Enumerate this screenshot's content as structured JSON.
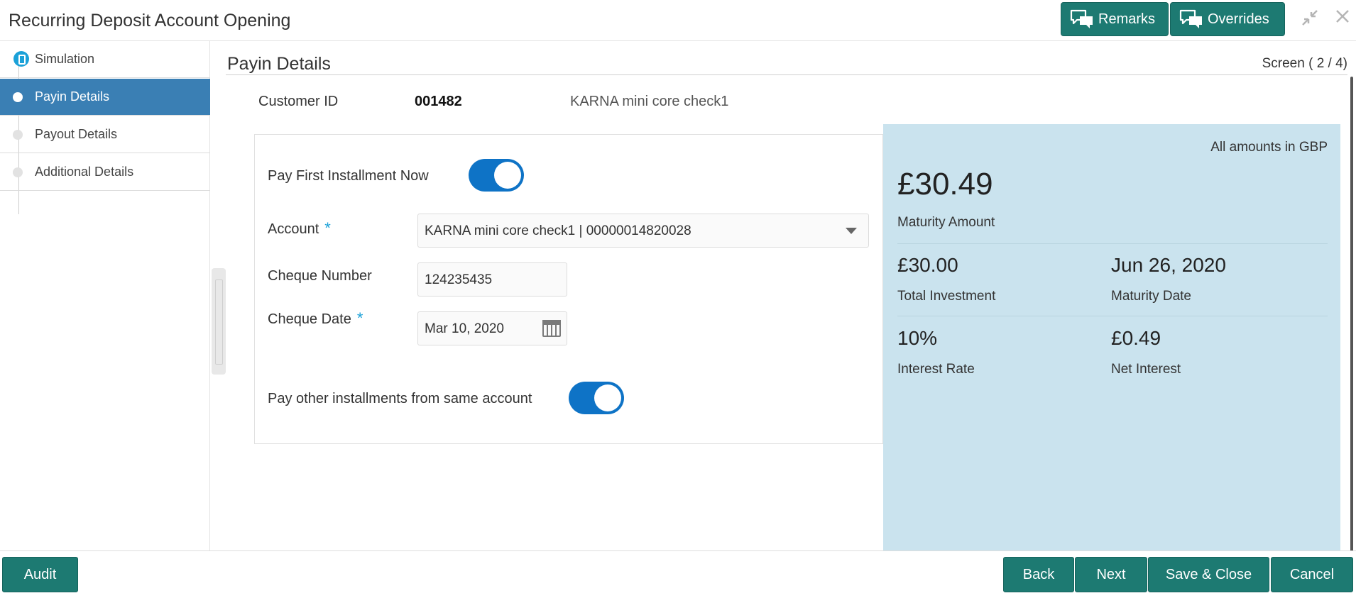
{
  "header": {
    "title": "Recurring Deposit Account Opening",
    "remarks_label": "Remarks",
    "overrides_label": "Overrides"
  },
  "sidebar": {
    "steps": [
      {
        "label": "Simulation",
        "state": "completed"
      },
      {
        "label": "Payin Details",
        "state": "active"
      },
      {
        "label": "Payout Details",
        "state": "pending"
      },
      {
        "label": "Additional Details",
        "state": "pending"
      }
    ]
  },
  "main": {
    "section_title": "Payin Details",
    "screen_indicator": "Screen ( 2 / 4)",
    "customer": {
      "label": "Customer ID",
      "id": "001482",
      "name": "KARNA mini core check1"
    },
    "form": {
      "pay_first_label": "Pay First Installment Now",
      "pay_first_on": true,
      "account_label": "Account",
      "account_value": "KARNA mini core check1 | 00000014820028",
      "cheque_number_label": "Cheque Number",
      "cheque_number_value": "124235435",
      "cheque_date_label": "Cheque Date",
      "cheque_date_value": "Mar 10, 2020",
      "pay_other_label": "Pay other installments from same account",
      "pay_other_on": true,
      "required_mark": "*"
    },
    "summary": {
      "note": "All amounts in GBP",
      "maturity_amount_value": "£30.49",
      "maturity_amount_label": "Maturity Amount",
      "total_investment_value": "£30.00",
      "total_investment_label": "Total Investment",
      "maturity_date_value": "Jun 26, 2020",
      "maturity_date_label": "Maturity Date",
      "interest_rate_value": "10%",
      "interest_rate_label": "Interest Rate",
      "net_interest_value": "£0.49",
      "net_interest_label": "Net Interest"
    }
  },
  "footer": {
    "audit": "Audit",
    "back": "Back",
    "next": "Next",
    "save_close": "Save & Close",
    "cancel": "Cancel"
  },
  "colors": {
    "primary_button": "#1d7a72",
    "active_step": "#3a7fb4",
    "toggle_on": "#0e73c6",
    "summary_bg": "#cae3ee",
    "required": "#1ba1d8"
  }
}
